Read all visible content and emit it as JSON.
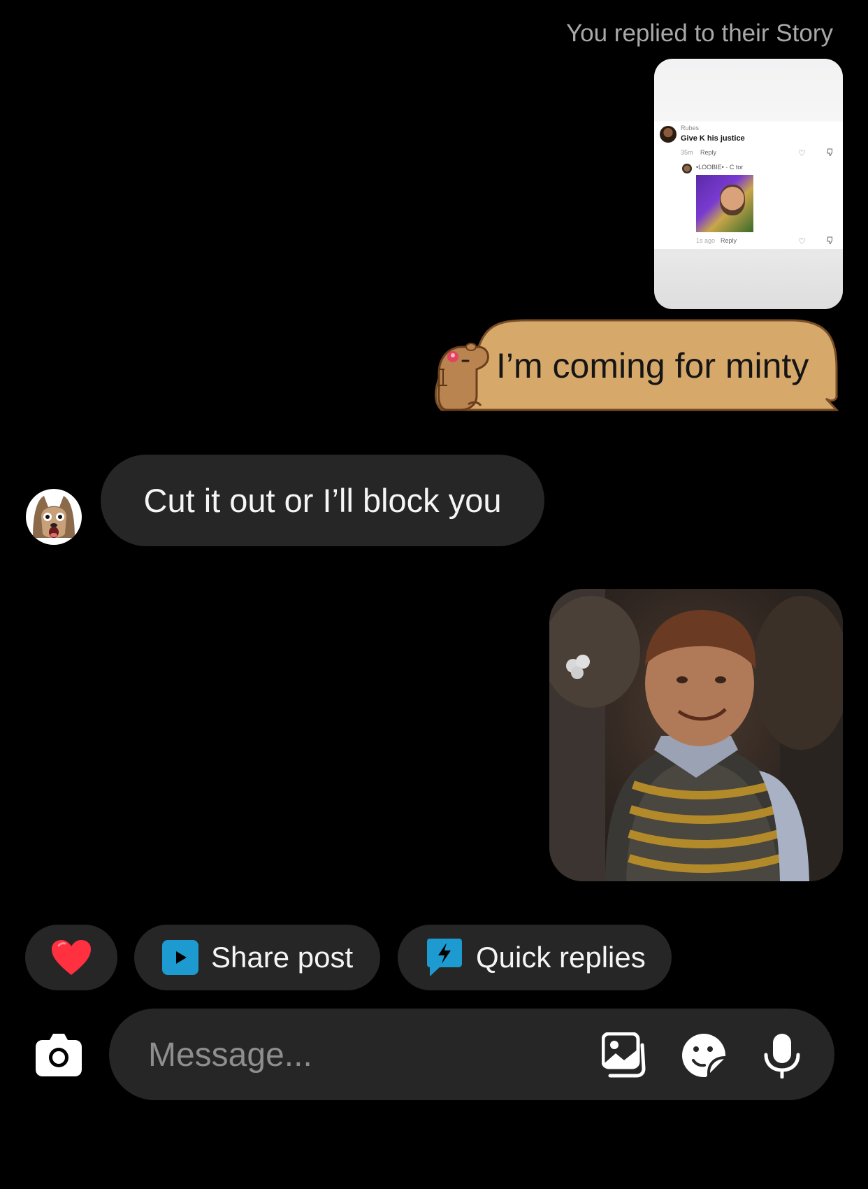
{
  "thread": {
    "story_reply_header": "You replied to their Story",
    "story_card": {
      "username": "Rubes",
      "comment": "Give K his justice",
      "time": "35m",
      "reply_label": "Reply",
      "nested_username": "•LOOBIE• · C   tor",
      "nested_time": "1s ago",
      "nested_reply_label": "Reply"
    },
    "sent_sticker_message": "I’m coming for minty",
    "received_message": "Cut it out or I’ll block you"
  },
  "quick_actions": {
    "share_post": "Share post",
    "quick_replies": "Quick replies"
  },
  "composer": {
    "placeholder": "Message..."
  },
  "colors": {
    "background": "#000000",
    "bubble": "#262626",
    "capybara_bubble": "#d6a96b",
    "accent_blue": "#1d9bd1",
    "heart_red": "#ff3040"
  },
  "icons": [
    "camera-icon",
    "gallery-icon",
    "sticker-icon",
    "microphone-icon",
    "heart-icon",
    "share-post-icon",
    "quick-replies-icon"
  ]
}
